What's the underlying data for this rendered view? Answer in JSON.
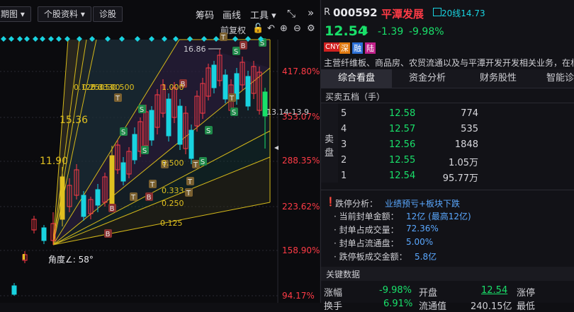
{
  "toolbar": {
    "buttons": [
      "期图",
      "个股资料",
      "诊股"
    ],
    "links": [
      "筹码",
      "画线",
      "工具"
    ],
    "fq_label": "前复权"
  },
  "chart": {
    "pct_labels": [
      "417.80%",
      "353.07%",
      "288.35%",
      "223.62%",
      "158.90%",
      "94.17%"
    ],
    "fan_ratios": [
      "0.125",
      "0.250",
      "0.333",
      "0.500",
      "1.000",
      "0.125",
      "0.250",
      "0.333",
      "0.500"
    ],
    "price_labels": {
      "p1536": "15.36",
      "p1190": "11.90",
      "p1686": "16.86",
      "p1314": "13.14-13.9"
    },
    "angle_label": "角度∠: 58°",
    "colors": {
      "up": "#ff3b46",
      "down": "#19d3e0",
      "yellow": "#e0c020",
      "fan_line": "#d4b81a"
    }
  },
  "quote": {
    "prefix": "R",
    "code": "000592",
    "name": "平潭发展",
    "ma_label": "20线14.73",
    "price": "12.54",
    "change": "-1.39",
    "change_pct": "-9.98%",
    "tags": [
      "CNY",
      "深",
      "融",
      "陆"
    ],
    "business": "主营纤维板、商品房、农贸流通以及与平潭开发开发相关业务，在林"
  },
  "tabs": [
    "综合看盘",
    "资金分析",
    "财务股性",
    "智能诊"
  ],
  "orderbook": {
    "title": "买卖五档（手）",
    "side_label": [
      "卖",
      "盘"
    ],
    "rows": [
      {
        "level": "5",
        "price": "12.58",
        "vol": "774"
      },
      {
        "level": "4",
        "price": "12.57",
        "vol": "535"
      },
      {
        "level": "3",
        "price": "12.56",
        "vol": "1848"
      },
      {
        "level": "2",
        "price": "12.55",
        "vol": "1.05万"
      },
      {
        "level": "1",
        "price": "12.54",
        "vol": "95.77万"
      }
    ]
  },
  "limit_down": {
    "title": "跌停分析：",
    "title_value": "业绩预亏+板块下跌",
    "lines": [
      {
        "label": "· 当前封单金额：",
        "value": "12亿 (最高12亿)"
      },
      {
        "label": "· 封单占成交量：",
        "value": "72.36%"
      },
      {
        "label": "· 封单占流通盘：",
        "value": "5.00%"
      },
      {
        "label": "· 跌停板成交金额：",
        "value": "5.8亿"
      }
    ]
  },
  "key_data": {
    "title": "关键数据",
    "r1": {
      "l1": "涨幅",
      "v1": "-9.98%",
      "l2": "开盘",
      "v2": "12.54",
      "l3": "涨停"
    },
    "r2": {
      "l1": "换手",
      "v1": "6.91%",
      "l2": "流通值",
      "v2": "240.15亿",
      "l3": "最低"
    }
  }
}
